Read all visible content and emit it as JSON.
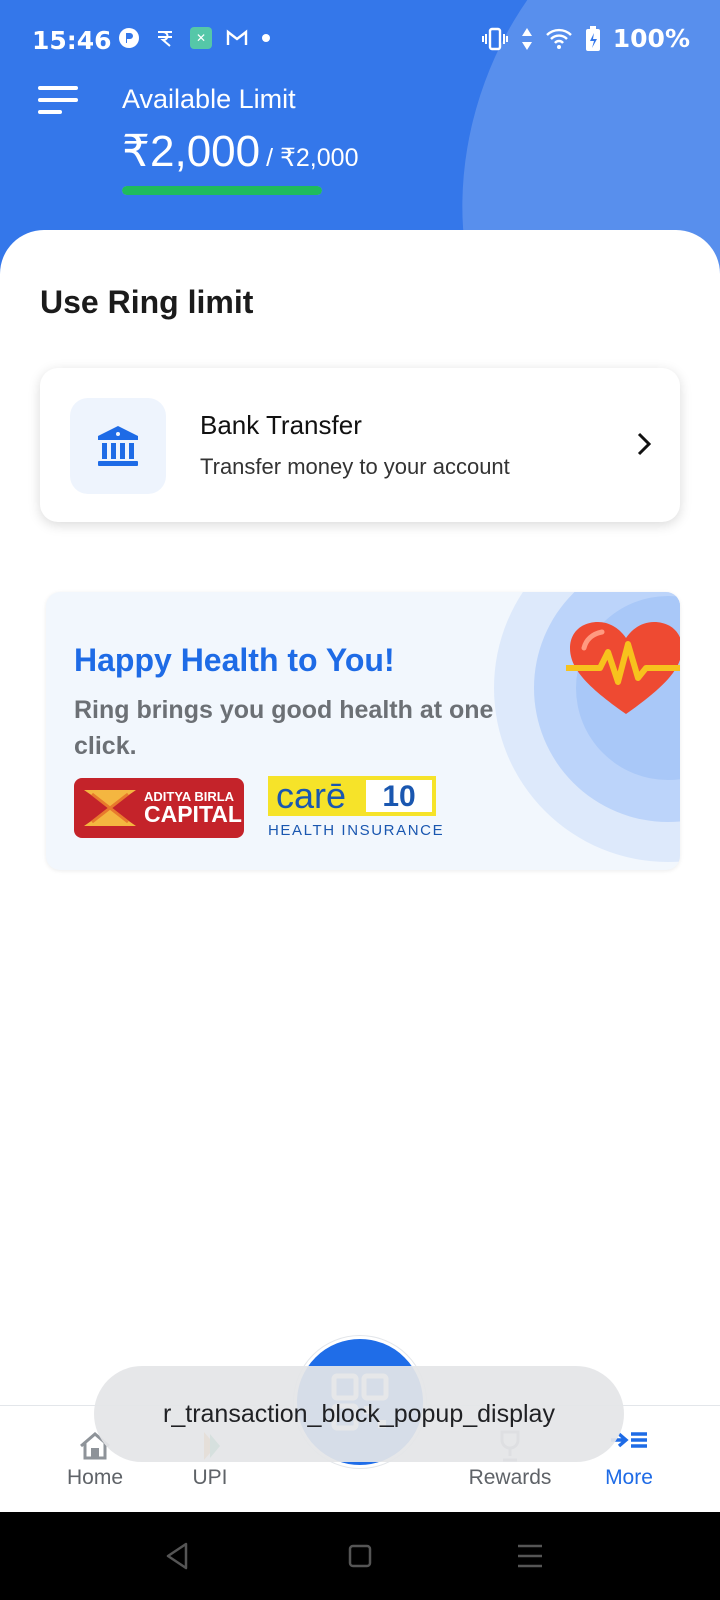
{
  "status_bar": {
    "time": "15:46",
    "battery": "100%",
    "left_icons": [
      "notification-app-icon",
      "rupee-icon",
      "app-badge-icon",
      "gmail-icon",
      "dot-icon"
    ],
    "right_icons": [
      "vibrate-icon",
      "data-arrows-icon",
      "wifi-icon",
      "battery-charging-icon"
    ]
  },
  "header": {
    "title": "Available Limit",
    "available": "₹2,000",
    "total": "/ ₹2,000",
    "limit_used_fraction": 1.0,
    "bar_color": "#1fbb5c",
    "bg_color": "#3477ea"
  },
  "main": {
    "section_title": "Use Ring limit",
    "bank_card": {
      "title": "Bank Transfer",
      "subtitle": "Transfer money to your account"
    },
    "banner": {
      "title": "Happy Health to You!",
      "text": "Ring brings you good health at one click.",
      "partner1": {
        "line1": "ADITYA BIRLA",
        "line2": "CAPITAL"
      },
      "partner2": {
        "word": "carē",
        "badge": "10",
        "sub": "HEALTH INSURANCE"
      }
    }
  },
  "bottom_nav": {
    "items": [
      {
        "label": "Home",
        "icon": "home-icon"
      },
      {
        "label": "UPI",
        "icon": "upi-icon"
      },
      {
        "label": "Rewards",
        "icon": "rewards-icon"
      },
      {
        "label": "More",
        "icon": "more-icon",
        "active": true
      }
    ],
    "center_icon": "qr-scan-icon"
  },
  "toast": {
    "text": "r_transaction_block_popup_display"
  }
}
